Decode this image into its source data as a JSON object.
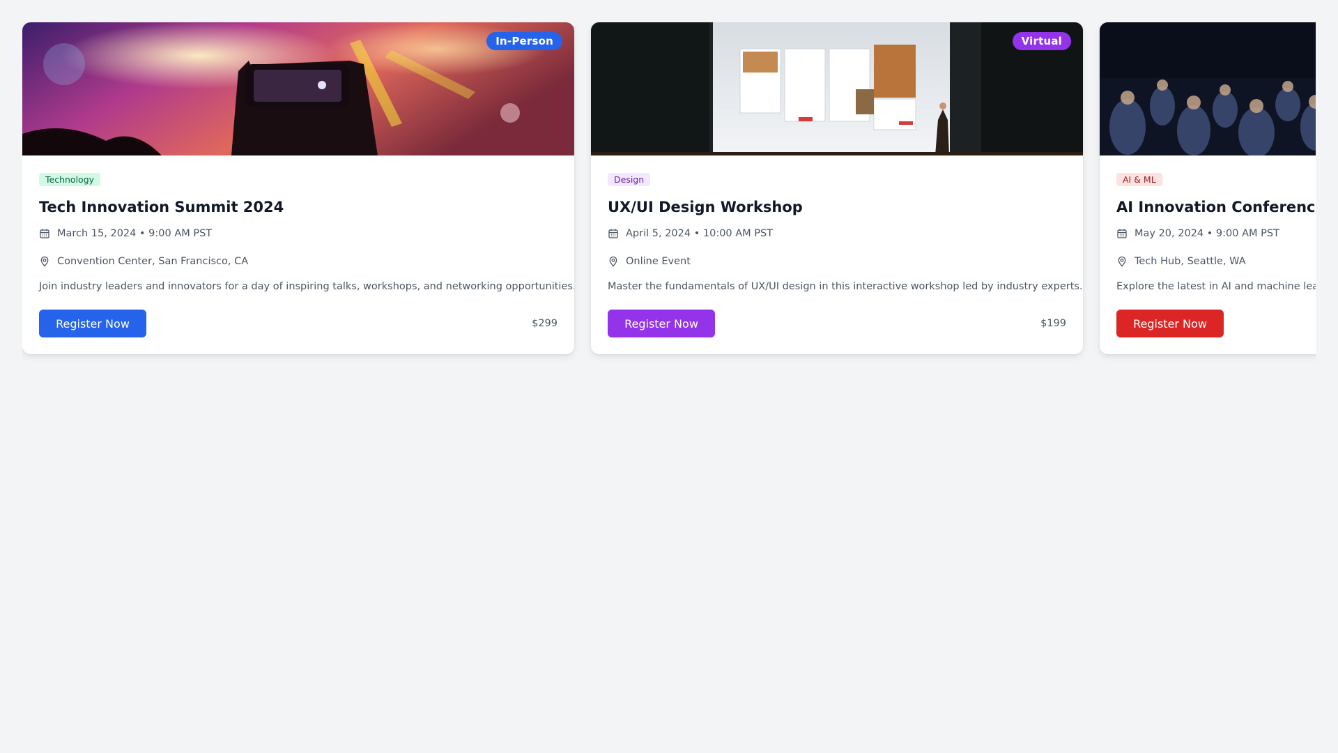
{
  "events": [
    {
      "format_badge": "In-Person",
      "category": "Technology",
      "title": "Tech Innovation Summit 2024",
      "datetime": "March 15, 2024 • 9:00 AM PST",
      "location": "Convention Center, San Francisco, CA",
      "description": "Join industry leaders and innovators for a day of inspiring talks, workshops, and networking opportunities.",
      "cta_label": "Register Now",
      "price": "$299",
      "colors": {
        "accent": "#2563eb",
        "category_bg": "#d1fae5",
        "category_text": "#065f46"
      }
    },
    {
      "format_badge": "Virtual",
      "category": "Design",
      "title": "UX/UI Design Workshop",
      "datetime": "April 5, 2024 • 10:00 AM PST",
      "location": "Online Event",
      "description": "Master the fundamentals of UX/UI design in this interactive workshop led by industry experts.",
      "cta_label": "Register Now",
      "price": "$199",
      "colors": {
        "accent": "#9333ea",
        "category_bg": "#f3e8ff",
        "category_text": "#6b21a8"
      }
    },
    {
      "category": "AI & ML",
      "title": "AI Innovation Conference",
      "datetime": "May 20, 2024 • 9:00 AM PST",
      "location": "Tech Hub, Seattle, WA",
      "description": "Explore the latest in AI and machine lear",
      "cta_label": "Register Now",
      "colors": {
        "accent": "#dc2626",
        "category_bg": "#fee2e2",
        "category_text": "#991b1b"
      }
    }
  ],
  "icons": {
    "date": "calendar-icon",
    "location": "map-pin-icon"
  }
}
